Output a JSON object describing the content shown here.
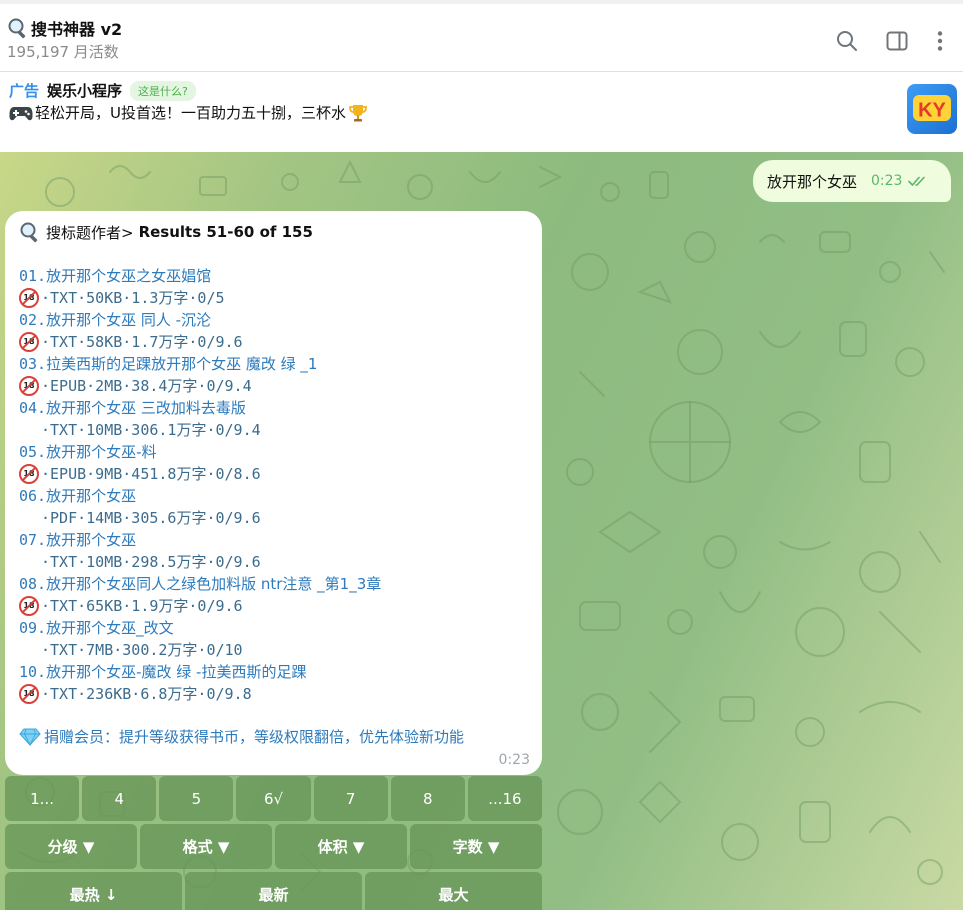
{
  "header": {
    "title": "搜书神器 v2",
    "subtitle": "195,197 月活数",
    "icons": [
      "search-icon",
      "sidebar-toggle-icon",
      "more-vertical-icon"
    ]
  },
  "ad": {
    "label": "广告",
    "name": "娱乐小程序",
    "whatis": "这是什么?",
    "text": "轻松开局，U投首选！一百助力五十捌，三杯水",
    "logo_text": "KY"
  },
  "outgoing": {
    "text": "放开那个女巫",
    "time": "0:23"
  },
  "message": {
    "header_prefix": "搜标题作者>",
    "header_results": "Results 51-60 of 155",
    "results": [
      {
        "num": "01.",
        "title": "放开那个女巫之女巫娼馆",
        "adult": true,
        "meta": "·TXT·50KB·1.3万字·0/5"
      },
      {
        "num": "02.",
        "title": "放开那个女巫 同人 -沉沦",
        "adult": true,
        "meta": "·TXT·58KB·1.7万字·0/9.6"
      },
      {
        "num": "03.",
        "title": "拉美西斯的足踝放开那个女巫 魔改 绿 _1",
        "adult": true,
        "meta": "·EPUB·2MB·38.4万字·0/9.4"
      },
      {
        "num": "04.",
        "title": "放开那个女巫 三改加料去毒版",
        "adult": false,
        "meta": "·TXT·10MB·306.1万字·0/9.4"
      },
      {
        "num": "05.",
        "title": "放开那个女巫-料",
        "adult": true,
        "meta": "·EPUB·9MB·451.8万字·0/8.6"
      },
      {
        "num": "06.",
        "title": "放开那个女巫",
        "adult": false,
        "meta": "·PDF·14MB·305.6万字·0/9.6"
      },
      {
        "num": "07.",
        "title": "放开那个女巫",
        "adult": false,
        "meta": "·TXT·10MB·298.5万字·0/9.6"
      },
      {
        "num": "08.",
        "title": "放开那个女巫同人之绿色加料版 ntr注意 _第1_3章",
        "adult": true,
        "meta": "·TXT·65KB·1.9万字·0/9.6"
      },
      {
        "num": "09.",
        "title": "放开那个女巫_改文",
        "adult": false,
        "meta": "·TXT·7MB·300.2万字·0/10"
      },
      {
        "num": "10.",
        "title": "放开那个女巫-魔改 绿 -拉美西斯的足踝",
        "adult": true,
        "meta": "·TXT·236KB·6.8万字·0/9.8"
      }
    ],
    "promo": "捐赠会员：提升等级获得书币，等级权限翻倍，优先体验新功能",
    "time": "0:23"
  },
  "keyboard": {
    "row1": [
      "1...",
      "4",
      "5",
      "6√",
      "7",
      "8",
      "...16"
    ],
    "row2": [
      "分级 ▼",
      "格式 ▼",
      "体积 ▼",
      "字数 ▼"
    ],
    "row3": [
      "最热 ↓",
      "最新",
      "最大"
    ]
  }
}
